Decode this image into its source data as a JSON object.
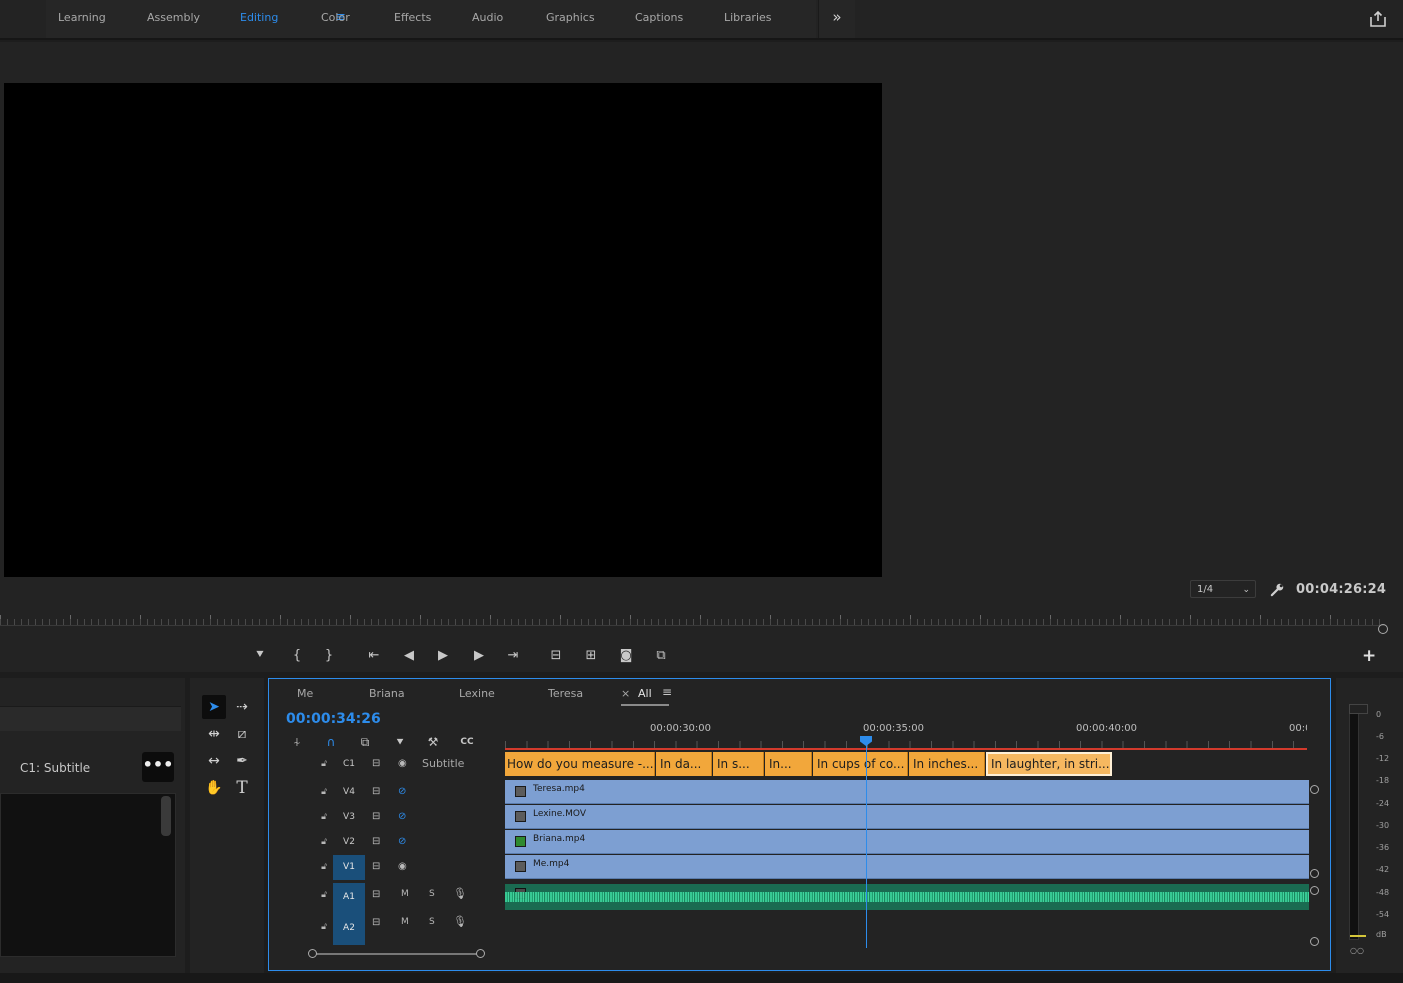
{
  "workspaces": {
    "tabs": [
      "Learning",
      "Assembly",
      "Editing",
      "Color",
      "Effects",
      "Audio",
      "Graphics",
      "Captions",
      "Libraries"
    ],
    "active": "Editing",
    "overflow_label": "»"
  },
  "program_monitor": {
    "resolution": "1/4",
    "duration_timecode": "00:04:26:24",
    "controls": [
      "add-marker",
      "mark-in",
      "mark-out",
      "go-to-in",
      "step-back",
      "play",
      "step-forward",
      "go-to-out",
      "lift",
      "extract",
      "export-frame",
      "comparison-view"
    ],
    "add_button_label": "+"
  },
  "essential_graphics": {
    "layer_label": "C1: Subtitle",
    "more_label": "•••"
  },
  "timeline": {
    "sequence_tabs": [
      "Me",
      "Briana",
      "Lexine",
      "Teresa",
      "All"
    ],
    "active_tab": "All",
    "close_label": "×",
    "timecode": "00:00:34:26",
    "ruler_labels": [
      "00:00:30:00",
      "00:00:35:00",
      "00:00:40:00",
      "00:0("
    ],
    "caption_track": {
      "label": "C1",
      "name": "Subtitle"
    },
    "captions": [
      "How do you measure -...",
      "In da...",
      "In s...",
      "In...",
      "In cups of co...",
      "In inches...",
      "In laughter, in stri..."
    ],
    "video_tracks": [
      {
        "label": "V4",
        "clip": "Teresa.mp4",
        "visible": false,
        "targeted": false
      },
      {
        "label": "V3",
        "clip": "Lexine.MOV",
        "visible": false,
        "targeted": false
      },
      {
        "label": "V2",
        "clip": "Briana.mp4",
        "visible": false,
        "targeted": false
      },
      {
        "label": "V1",
        "clip": "Me.mp4",
        "visible": true,
        "targeted": true
      }
    ],
    "audio_tracks": [
      {
        "label": "A1",
        "mute": "M",
        "solo": "S",
        "targeted": true
      },
      {
        "label": "A2",
        "mute": "M",
        "solo": "S",
        "targeted": true
      }
    ]
  },
  "audio_meter": {
    "scale": [
      "0",
      "-6",
      "-12",
      "-18",
      "-24",
      "-30",
      "-36",
      "-42",
      "-48",
      "-54",
      "dB"
    ]
  }
}
